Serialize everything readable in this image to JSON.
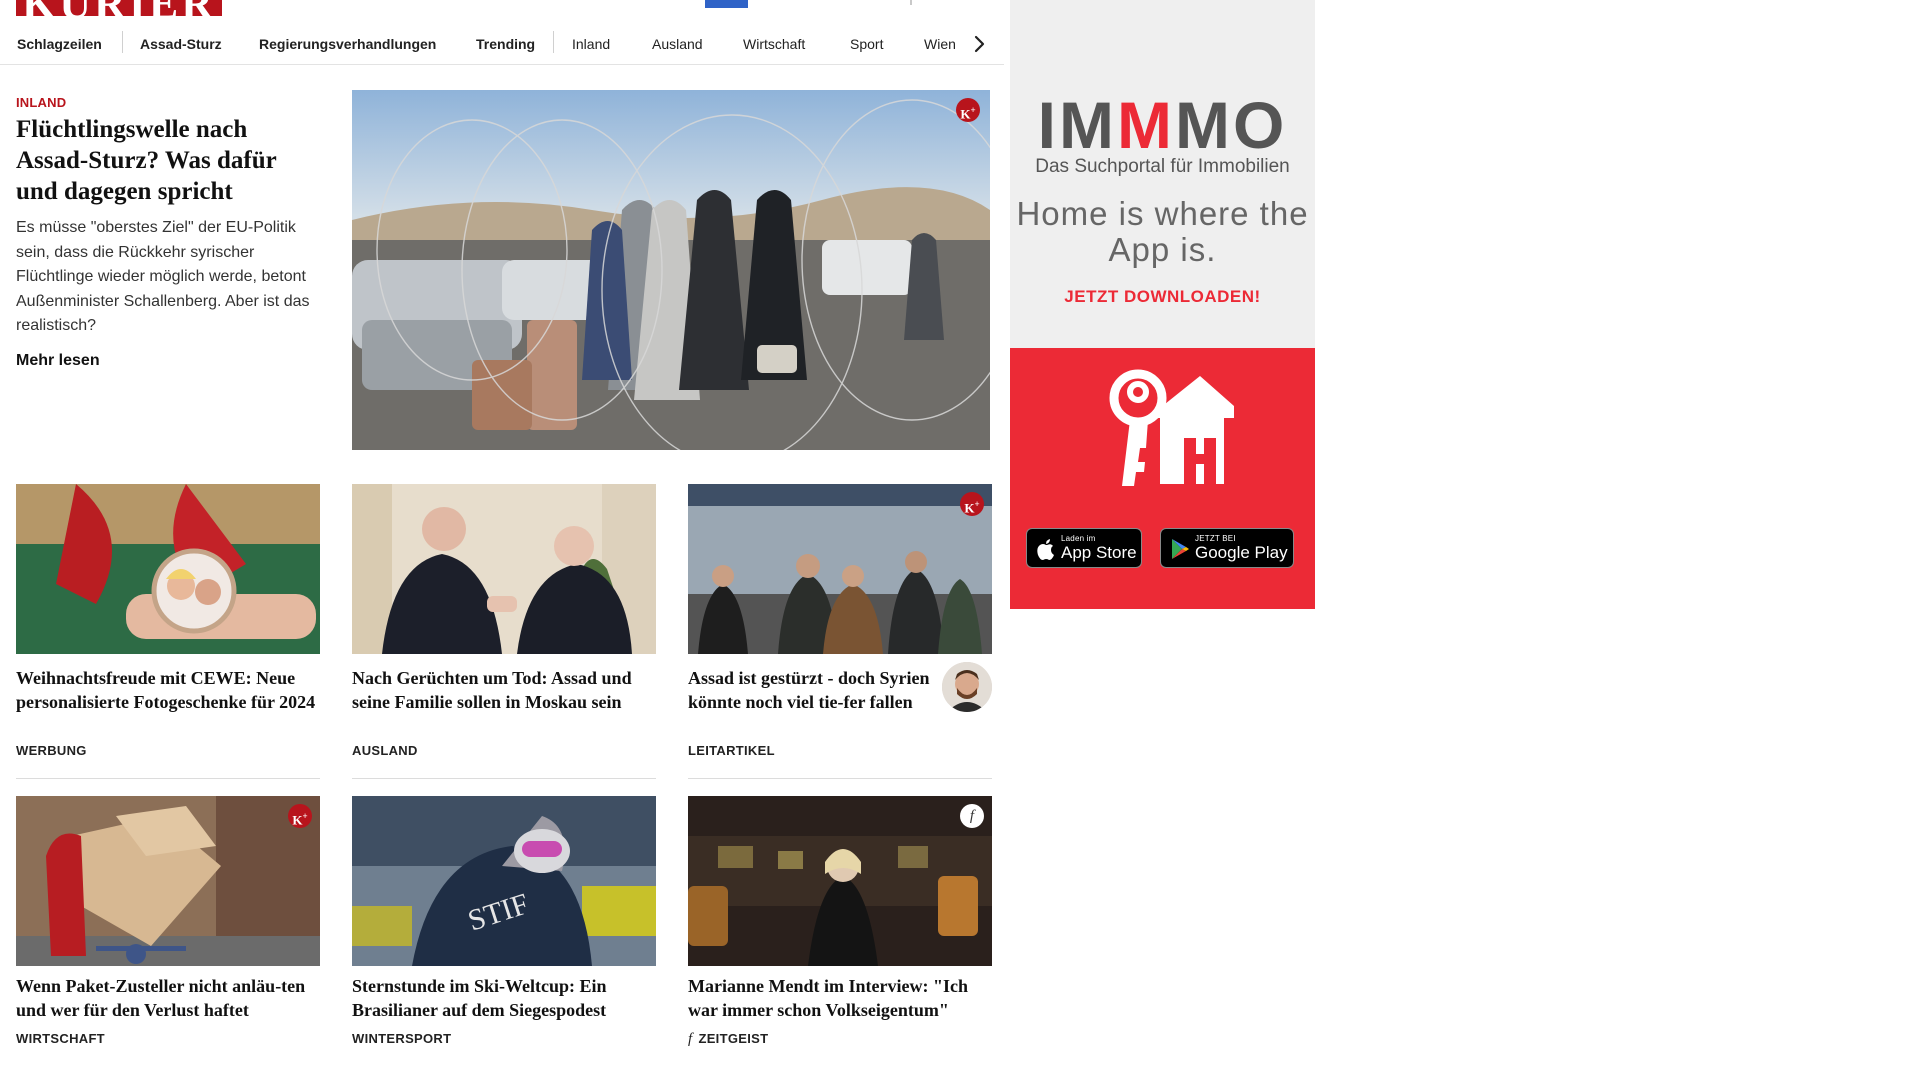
{
  "header": {
    "logo_text": "KURIER",
    "nav": [
      {
        "label": "Schlagzeilen"
      },
      {
        "label": "Assad-Sturz"
      },
      {
        "label": "Regierungsverhandlungen"
      },
      {
        "label": "Trending"
      },
      {
        "label": "Inland"
      },
      {
        "label": "Ausland"
      },
      {
        "label": "Wirtschaft"
      },
      {
        "label": "Sport"
      },
      {
        "label": "Wien"
      }
    ]
  },
  "lead": {
    "category": "INLAND",
    "title": "Flüchtlingswelle nach Assad-Sturz? Was dafür und dagegen spricht",
    "teaser": "Es müsse \"oberstes Ziel\" der EU-Politik sein, dass die Rückkehr syrischer Flüchtlinge wieder möglich werde, betont Außenminister Schallenberg. Aber ist das realistisch?",
    "more": "Mehr lesen",
    "badge": "K+"
  },
  "cards": [
    {
      "title": "Weihnachtsfreude mit CEWE: Neue personalisierte Fotogeschenke für 2024",
      "meta": "WERBUNG"
    },
    {
      "title": "Nach Gerüchten um Tod: Assad und seine Familie sollen in Moskau sein",
      "meta": "AUSLAND"
    },
    {
      "title": "Assad ist gestürzt - doch Syrien könnte noch viel tie-fer fallen",
      "meta": "LEITARTIKEL",
      "badge": "K+"
    },
    {
      "title": "Wenn Paket-Zusteller nicht anläu-ten und wer für den Verlust haftet",
      "meta": "WIRTSCHAFT",
      "badge": "K+"
    },
    {
      "title": "Sternstunde im Ski-Weltcup: Ein Brasilianer auf dem Siegespodest",
      "meta": "WINTERSPORT"
    },
    {
      "title": "Marianne Mendt im Interview: \"Ich war immer schon Volkseigentum\"",
      "meta": "ZEITGEIST",
      "badge": "f",
      "meta_icon": "f"
    }
  ],
  "ad": {
    "brand_prefix": "IM",
    "brand_red": "M",
    "brand_suffix": "MO",
    "tagline": "Das Suchportal für Immobilien",
    "headline": "Home is where the App is.",
    "cta": "JETZT DOWNLOADEN!",
    "app_store_small": "Laden im",
    "app_store_big": "App Store",
    "google_small": "JETZT BEI",
    "google_big": "Google Play"
  },
  "colors": {
    "brand_red": "#b8141c",
    "ad_red": "#ec2a36",
    "ad_grey": "#efefef",
    "accent_blue": "#2f63c7"
  }
}
